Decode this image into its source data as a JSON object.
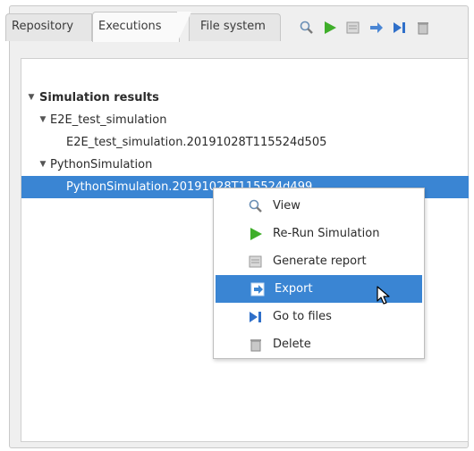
{
  "tabs": [
    {
      "label": "Repository"
    },
    {
      "label": "Executions"
    },
    {
      "label": "File system"
    }
  ],
  "toolbar": {
    "icons": [
      "magnifier-icon",
      "run-icon",
      "report-icon",
      "export-icon",
      "goto-files-icon",
      "delete-icon"
    ]
  },
  "tree": {
    "root": "Simulation results",
    "groups": [
      {
        "label": "E2E_test_simulation",
        "children": [
          "E2E_test_simulation.20191028T115524d505"
        ]
      },
      {
        "label": "PythonSimulation",
        "children": [
          "PythonSimulation.20191028T115524d499"
        ]
      }
    ]
  },
  "context_menu": {
    "items": [
      {
        "label": "View",
        "icon": "magnifier-icon"
      },
      {
        "label": "Re-Run Simulation",
        "icon": "run-icon"
      },
      {
        "label": "Generate report",
        "icon": "report-icon"
      },
      {
        "label": "Export",
        "icon": "export-icon"
      },
      {
        "label": "Go to files",
        "icon": "goto-files-icon"
      },
      {
        "label": "Delete",
        "icon": "delete-icon"
      }
    ],
    "highlighted": "Export"
  },
  "colors": {
    "selection": "#3a85d3",
    "run_green": "#3fae2a",
    "accent_blue": "#2f6fc9"
  }
}
